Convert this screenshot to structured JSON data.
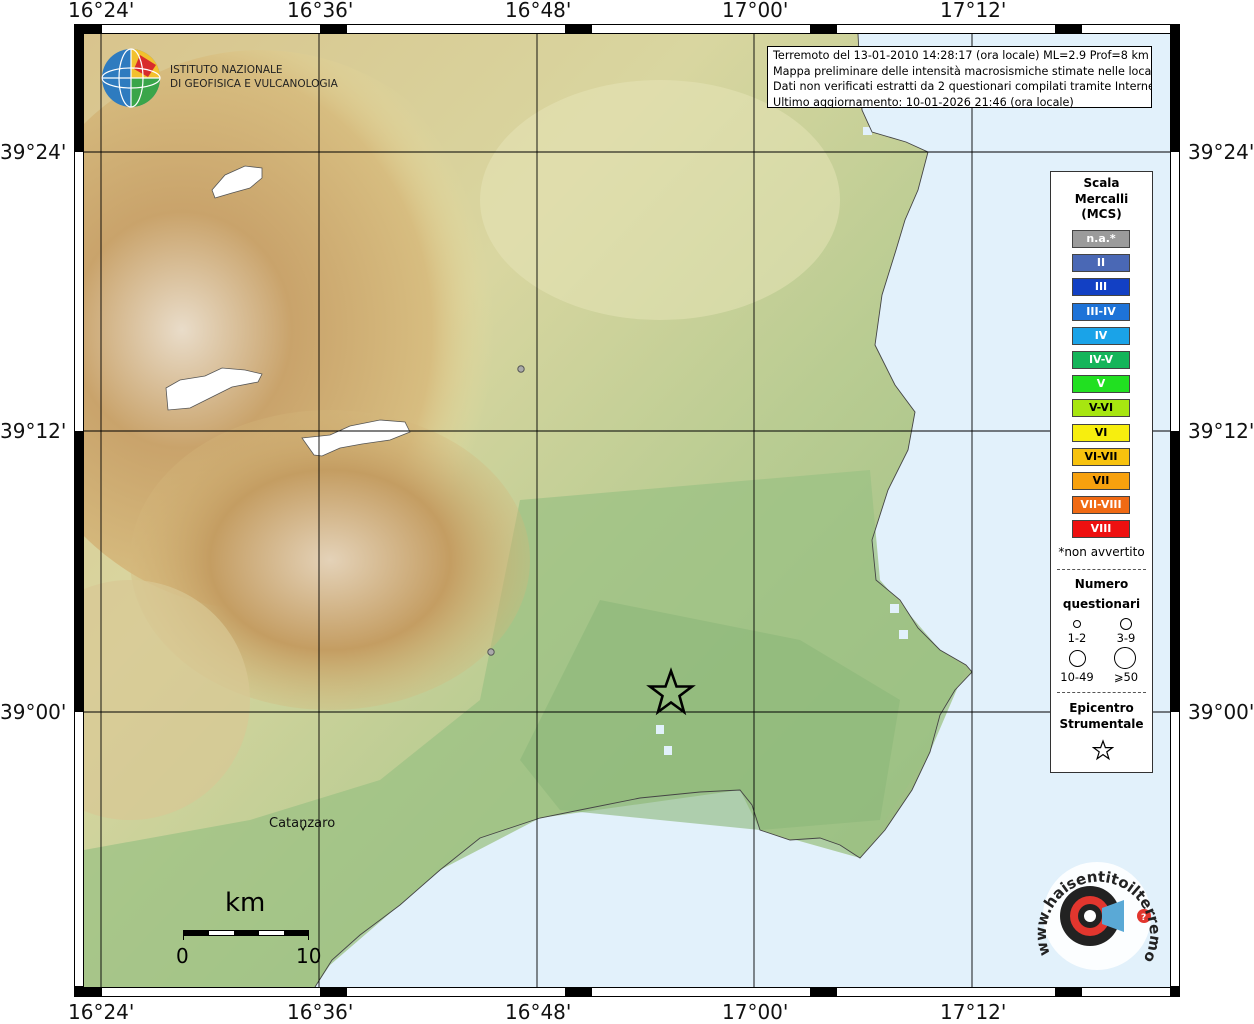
{
  "map": {
    "lon_labels": [
      "16°24'",
      "16°36'",
      "16°48'",
      "17°00'",
      "17°12'"
    ],
    "lat_labels": [
      "39°24'",
      "39°12'",
      "39°00'"
    ],
    "city": "Catanzaro",
    "colors": {
      "sea": "#e2f1fb",
      "grid": "#000000"
    }
  },
  "logo_ingv": {
    "line1": "ISTITUTO NAZIONALE",
    "line2": "DI GEOFISICA E VULCANOLOGIA"
  },
  "info": {
    "line1": "Terremoto del 13-01-2010 14:28:17 (ora locale) ML=2.9 Prof=8 km",
    "line2": "Mappa preliminare delle intensità macrosismiche stimate nelle località",
    "line3": "Dati non verificati estratti da 2 questionari compilati tramite Internet.",
    "line4": "Ultimo aggiornamento: 10-01-2026 21:46 (ora locale)"
  },
  "legend": {
    "title_lines": [
      "Scala",
      "Mercalli",
      "(MCS)"
    ],
    "intensities": [
      {
        "label": "n.a.*",
        "color": "#9b9b9b"
      },
      {
        "label": "II",
        "color": "#4a68b5"
      },
      {
        "label": "III",
        "color": "#1240c4"
      },
      {
        "label": "III-IV",
        "color": "#1e73d8"
      },
      {
        "label": "IV",
        "color": "#1aa3e8"
      },
      {
        "label": "IV-V",
        "color": "#14b55a"
      },
      {
        "label": "V",
        "color": "#21e021"
      },
      {
        "label": "V-VI",
        "color": "#a7e610"
      },
      {
        "label": "VI",
        "color": "#f7ee0e"
      },
      {
        "label": "VI-VII",
        "color": "#f7c20e"
      },
      {
        "label": "VII",
        "color": "#f7a10e"
      },
      {
        "label": "VII-VIII",
        "color": "#f06a14"
      },
      {
        "label": "VIII",
        "color": "#ee1010"
      }
    ],
    "na_note": "*non avvertito",
    "count_title_lines": [
      "Numero",
      "questionari"
    ],
    "count_labels": [
      "1-2",
      "3-9",
      "10-49",
      "⩾50"
    ],
    "epicentre_lines": [
      "Epicentro",
      "Strumentale"
    ]
  },
  "scalebar": {
    "unit": "km",
    "start": "0",
    "end": "10"
  },
  "logo_hsit": {
    "text": "www.haisentitoilterremoto.it"
  }
}
